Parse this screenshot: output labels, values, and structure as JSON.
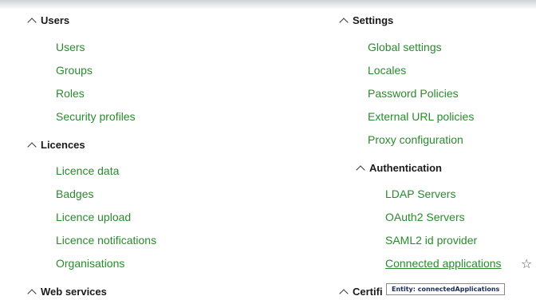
{
  "left": {
    "sections": [
      {
        "title": "Users",
        "items": [
          "Users",
          "Groups",
          "Roles",
          "Security profiles"
        ]
      },
      {
        "title": "Licences",
        "items": [
          "Licence data",
          "Badges",
          "Licence upload",
          "Licence notifications",
          "Organisations"
        ]
      },
      {
        "title": "Web services"
      }
    ]
  },
  "right": {
    "settings": {
      "title": "Settings",
      "items": [
        "Global settings",
        "Locales",
        "Password Policies",
        "External URL policies",
        "Proxy configuration"
      ]
    },
    "authentication": {
      "title": "Authentication",
      "items": [
        "LDAP Servers",
        "OAuth2 Servers",
        "SAML2 id provider",
        "Connected applications"
      ]
    },
    "next_section_partial": "Certifi"
  },
  "tooltip": {
    "text": "Entity: connectedApplications"
  },
  "icons": {
    "chevron": "chevron-up-icon",
    "star": "star-outline-icon"
  },
  "colors": {
    "link": "#2a8a2e",
    "heading": "#1a1a1a"
  }
}
